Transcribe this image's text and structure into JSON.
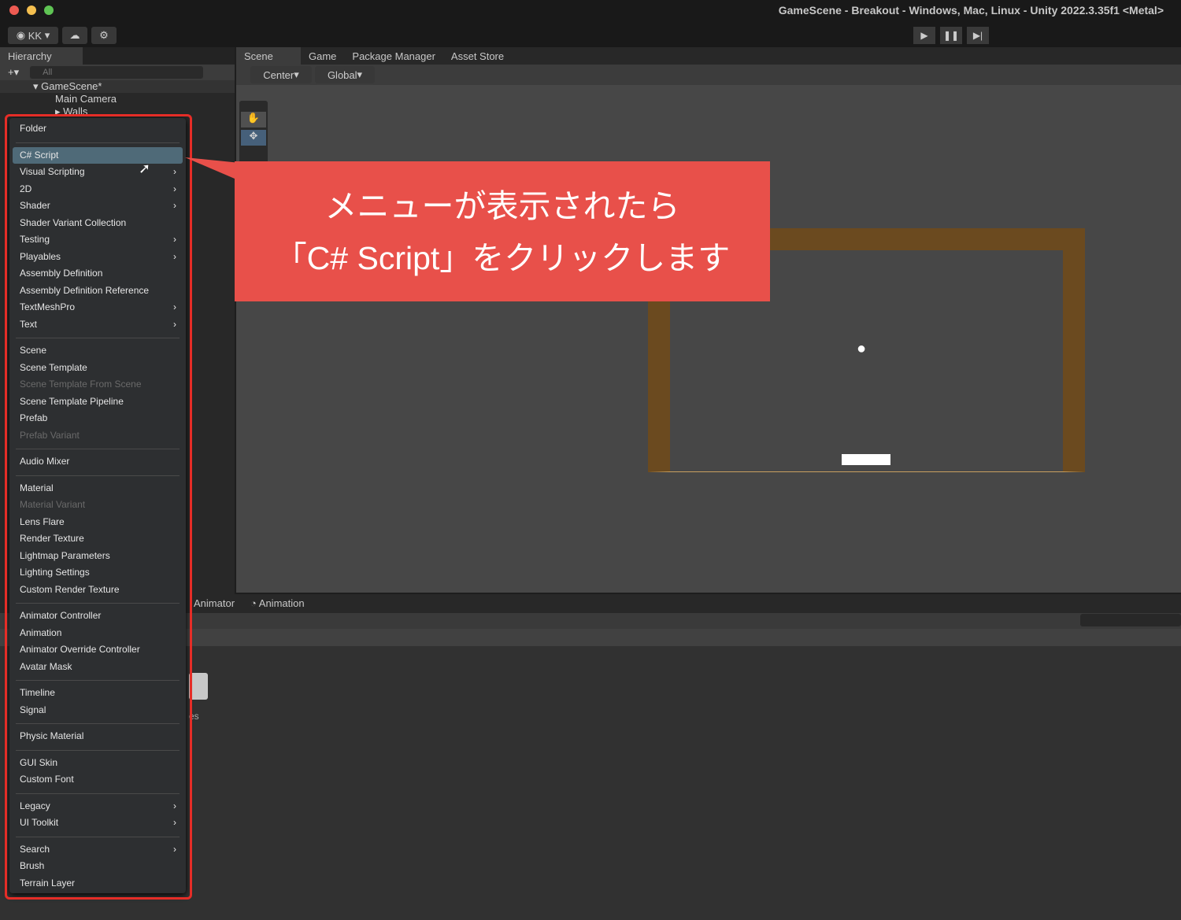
{
  "window": {
    "title": "GameScene - Breakout - Windows, Mac, Linux - Unity 2022.3.35f1 <Metal>"
  },
  "toolbar": {
    "account": "KK",
    "play_icon": "play-icon",
    "pause_icon": "pause-icon",
    "step_icon": "step-icon"
  },
  "hierarchy": {
    "tab": "Hierarchy",
    "search_placeholder": "All",
    "scene": "GameScene*",
    "items": [
      "Main Camera",
      "Walls"
    ]
  },
  "scene_tabs": [
    "Scene",
    "Game",
    "Package Manager",
    "Asset Store"
  ],
  "scene_toolbar": {
    "pivot": "Center",
    "space": "Global"
  },
  "bottom_tabs": [
    "Animator",
    "Animation"
  ],
  "bottom_fragment": "es",
  "menu": [
    {
      "label": "Folder"
    },
    {
      "sep": true
    },
    {
      "label": "C# Script",
      "highlighted": true
    },
    {
      "label": "Visual Scripting",
      "submenu": true
    },
    {
      "label": "2D",
      "submenu": true
    },
    {
      "label": "Shader",
      "submenu": true
    },
    {
      "label": "Shader Variant Collection"
    },
    {
      "label": "Testing",
      "submenu": true
    },
    {
      "label": "Playables",
      "submenu": true
    },
    {
      "label": "Assembly Definition"
    },
    {
      "label": "Assembly Definition Reference"
    },
    {
      "label": "TextMeshPro",
      "submenu": true
    },
    {
      "label": "Text",
      "submenu": true
    },
    {
      "sep": true
    },
    {
      "label": "Scene"
    },
    {
      "label": "Scene Template"
    },
    {
      "label": "Scene Template From Scene",
      "disabled": true
    },
    {
      "label": "Scene Template Pipeline"
    },
    {
      "label": "Prefab"
    },
    {
      "label": "Prefab Variant",
      "disabled": true
    },
    {
      "sep": true
    },
    {
      "label": "Audio Mixer"
    },
    {
      "sep": true
    },
    {
      "label": "Material"
    },
    {
      "label": "Material Variant",
      "disabled": true
    },
    {
      "label": "Lens Flare"
    },
    {
      "label": "Render Texture"
    },
    {
      "label": "Lightmap Parameters"
    },
    {
      "label": "Lighting Settings"
    },
    {
      "label": "Custom Render Texture"
    },
    {
      "sep": true
    },
    {
      "label": "Animator Controller"
    },
    {
      "label": "Animation"
    },
    {
      "label": "Animator Override Controller"
    },
    {
      "label": "Avatar Mask"
    },
    {
      "sep": true
    },
    {
      "label": "Timeline"
    },
    {
      "label": "Signal"
    },
    {
      "sep": true
    },
    {
      "label": "Physic Material"
    },
    {
      "sep": true
    },
    {
      "label": "GUI Skin"
    },
    {
      "label": "Custom Font"
    },
    {
      "sep": true
    },
    {
      "label": "Legacy",
      "submenu": true
    },
    {
      "label": "UI Toolkit",
      "submenu": true
    },
    {
      "sep": true
    },
    {
      "label": "Search",
      "submenu": true
    },
    {
      "label": "Brush"
    },
    {
      "label": "Terrain Layer"
    }
  ],
  "callout": {
    "line1": "メニューが表示されたら",
    "line2": "「C# Script」をクリックします",
    "color": "#e8504a"
  },
  "colors": {
    "highlight": "#4f6a78",
    "wall": "#6b4a1f",
    "annotation_frame": "#e52d27"
  }
}
